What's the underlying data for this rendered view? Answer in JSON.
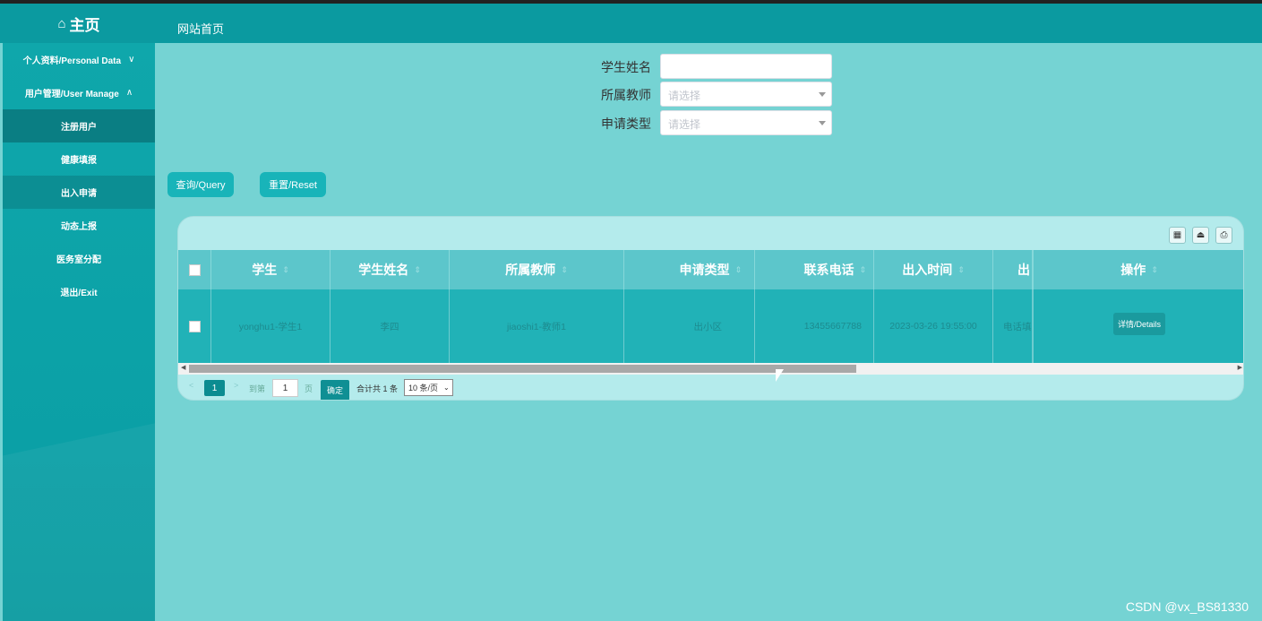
{
  "header": {
    "logo_icon": "home-icon",
    "logo_title": "主页",
    "site_home": "网站首页"
  },
  "sidebar": {
    "items": [
      {
        "label": "个人资料/Personal Data",
        "icon": "chevron-down-icon"
      },
      {
        "label": "用户管理/User Manage",
        "icon": "chevron-up-icon"
      }
    ],
    "subitems": [
      {
        "label": "注册用户"
      },
      {
        "label": "健康填报"
      },
      {
        "label": "出入申请"
      },
      {
        "label": "动态上报"
      },
      {
        "label": "医务室分配"
      },
      {
        "label": "退出/Exit"
      }
    ]
  },
  "search": {
    "student_name_label": "学生姓名",
    "student_name_value": "",
    "teacher_label": "所属教师",
    "teacher_placeholder": "请选择",
    "apply_type_label": "申请类型",
    "apply_type_placeholder": "请选择",
    "query_button": "查询/Query",
    "reset_button": "重置/Reset"
  },
  "table": {
    "columns": [
      "学生",
      "学生姓名",
      "所属教师",
      "申请类型",
      "联系电话",
      "出入时间",
      "出",
      "操作"
    ],
    "rows": [
      {
        "student": "yonghu1-学生1",
        "student_name": "李四",
        "teacher": "jiaoshi1-教师1",
        "apply_type": "出小区",
        "phone": "13455667788",
        "time": "2023-03-26 19:55:00",
        "extra": "电话填",
        "action": "详情/Details"
      }
    ]
  },
  "pager": {
    "prev": "<",
    "current": "1",
    "next": ">",
    "goto_label": "到第",
    "goto_value": "1",
    "page_unit": "页",
    "confirm": "确定",
    "total": "合计共 1 条",
    "page_size": "10 条/页"
  },
  "watermark": "CSDN @vx_BS81330"
}
